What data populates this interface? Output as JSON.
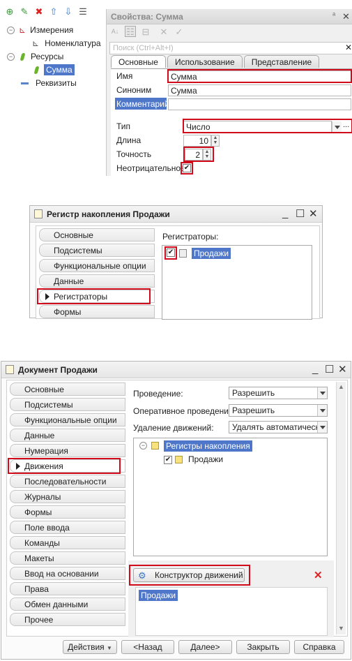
{
  "panel1": {
    "tree": [
      {
        "label": "Измерения"
      },
      {
        "label": "Номенклатура"
      },
      {
        "label": "Ресурсы"
      },
      {
        "label": "Сумма"
      },
      {
        "label": "Реквизиты"
      }
    ],
    "properties": {
      "title": "Свойства: Сумма",
      "pin_glyph": "ᵃ",
      "close_glyph": "✕",
      "search_placeholder": "Поиск (Ctrl+Alt+I)",
      "search_clear": "✕",
      "tabs": [
        {
          "label": "Основные",
          "active": true
        },
        {
          "label": "Использование",
          "active": false
        },
        {
          "label": "Представление",
          "active": false
        }
      ],
      "fields": {
        "name_label": "Имя",
        "name_value": "Сумма",
        "synonym_label": "Синоним",
        "synonym_value": "Сумма",
        "comment_label": "Комментарий",
        "comment_value": "",
        "type_label": "Тип",
        "type_value": "Число",
        "type_more": "...",
        "length_label": "Длина",
        "length_value": "10",
        "precision_label": "Точность",
        "precision_value": "2",
        "nonnegative_label": "Неотрицательное",
        "nonnegative_checked": true
      }
    }
  },
  "panel2": {
    "title": "Регистр накопления Продажи",
    "controls": {
      "minimize": "_",
      "maximize": "☐",
      "close": "✕"
    },
    "nav": [
      "Основные",
      "Подсистемы",
      "Функциональные опции",
      "Данные",
      "Регистраторы",
      "Формы"
    ],
    "active_nav": "Регистраторы",
    "registrars_label": "Регистраторы:",
    "registrars": [
      {
        "label": "Продажи",
        "checked": true
      }
    ]
  },
  "panel3": {
    "title": "Документ Продажи",
    "controls": {
      "minimize": "_",
      "maximize": "☐",
      "close": "✕"
    },
    "nav": [
      "Основные",
      "Подсистемы",
      "Функциональные опции",
      "Данные",
      "Нумерация",
      "Движения",
      "Последовательности",
      "Журналы",
      "Формы",
      "Поле ввода",
      "Команды",
      "Макеты",
      "Ввод на основании",
      "Права",
      "Обмен данными",
      "Прочее"
    ],
    "active_nav": "Движения",
    "posting_label": "Проведение:",
    "posting_value": "Разрешить",
    "realtime_posting_label": "Оперативное проведение:",
    "realtime_posting_value": "Разрешить",
    "delete_movements_label": "Удаление движений:",
    "delete_movements_value": "Удалять автоматически",
    "register_tree": {
      "group": "Регистры накопления",
      "items": [
        {
          "label": "Продажи",
          "checked": true
        }
      ]
    },
    "constructor_button": "Конструктор движений",
    "delete_glyph": "✕",
    "selected_register": "Продажи",
    "buttons": {
      "actions": "Действия",
      "back": "<Назад",
      "next": "Далее>",
      "close": "Закрыть",
      "help": "Справка"
    }
  },
  "colors": {
    "highlight": "#d10b1c",
    "selection": "#4f77c9",
    "comment_bg": "#4f77c9"
  }
}
